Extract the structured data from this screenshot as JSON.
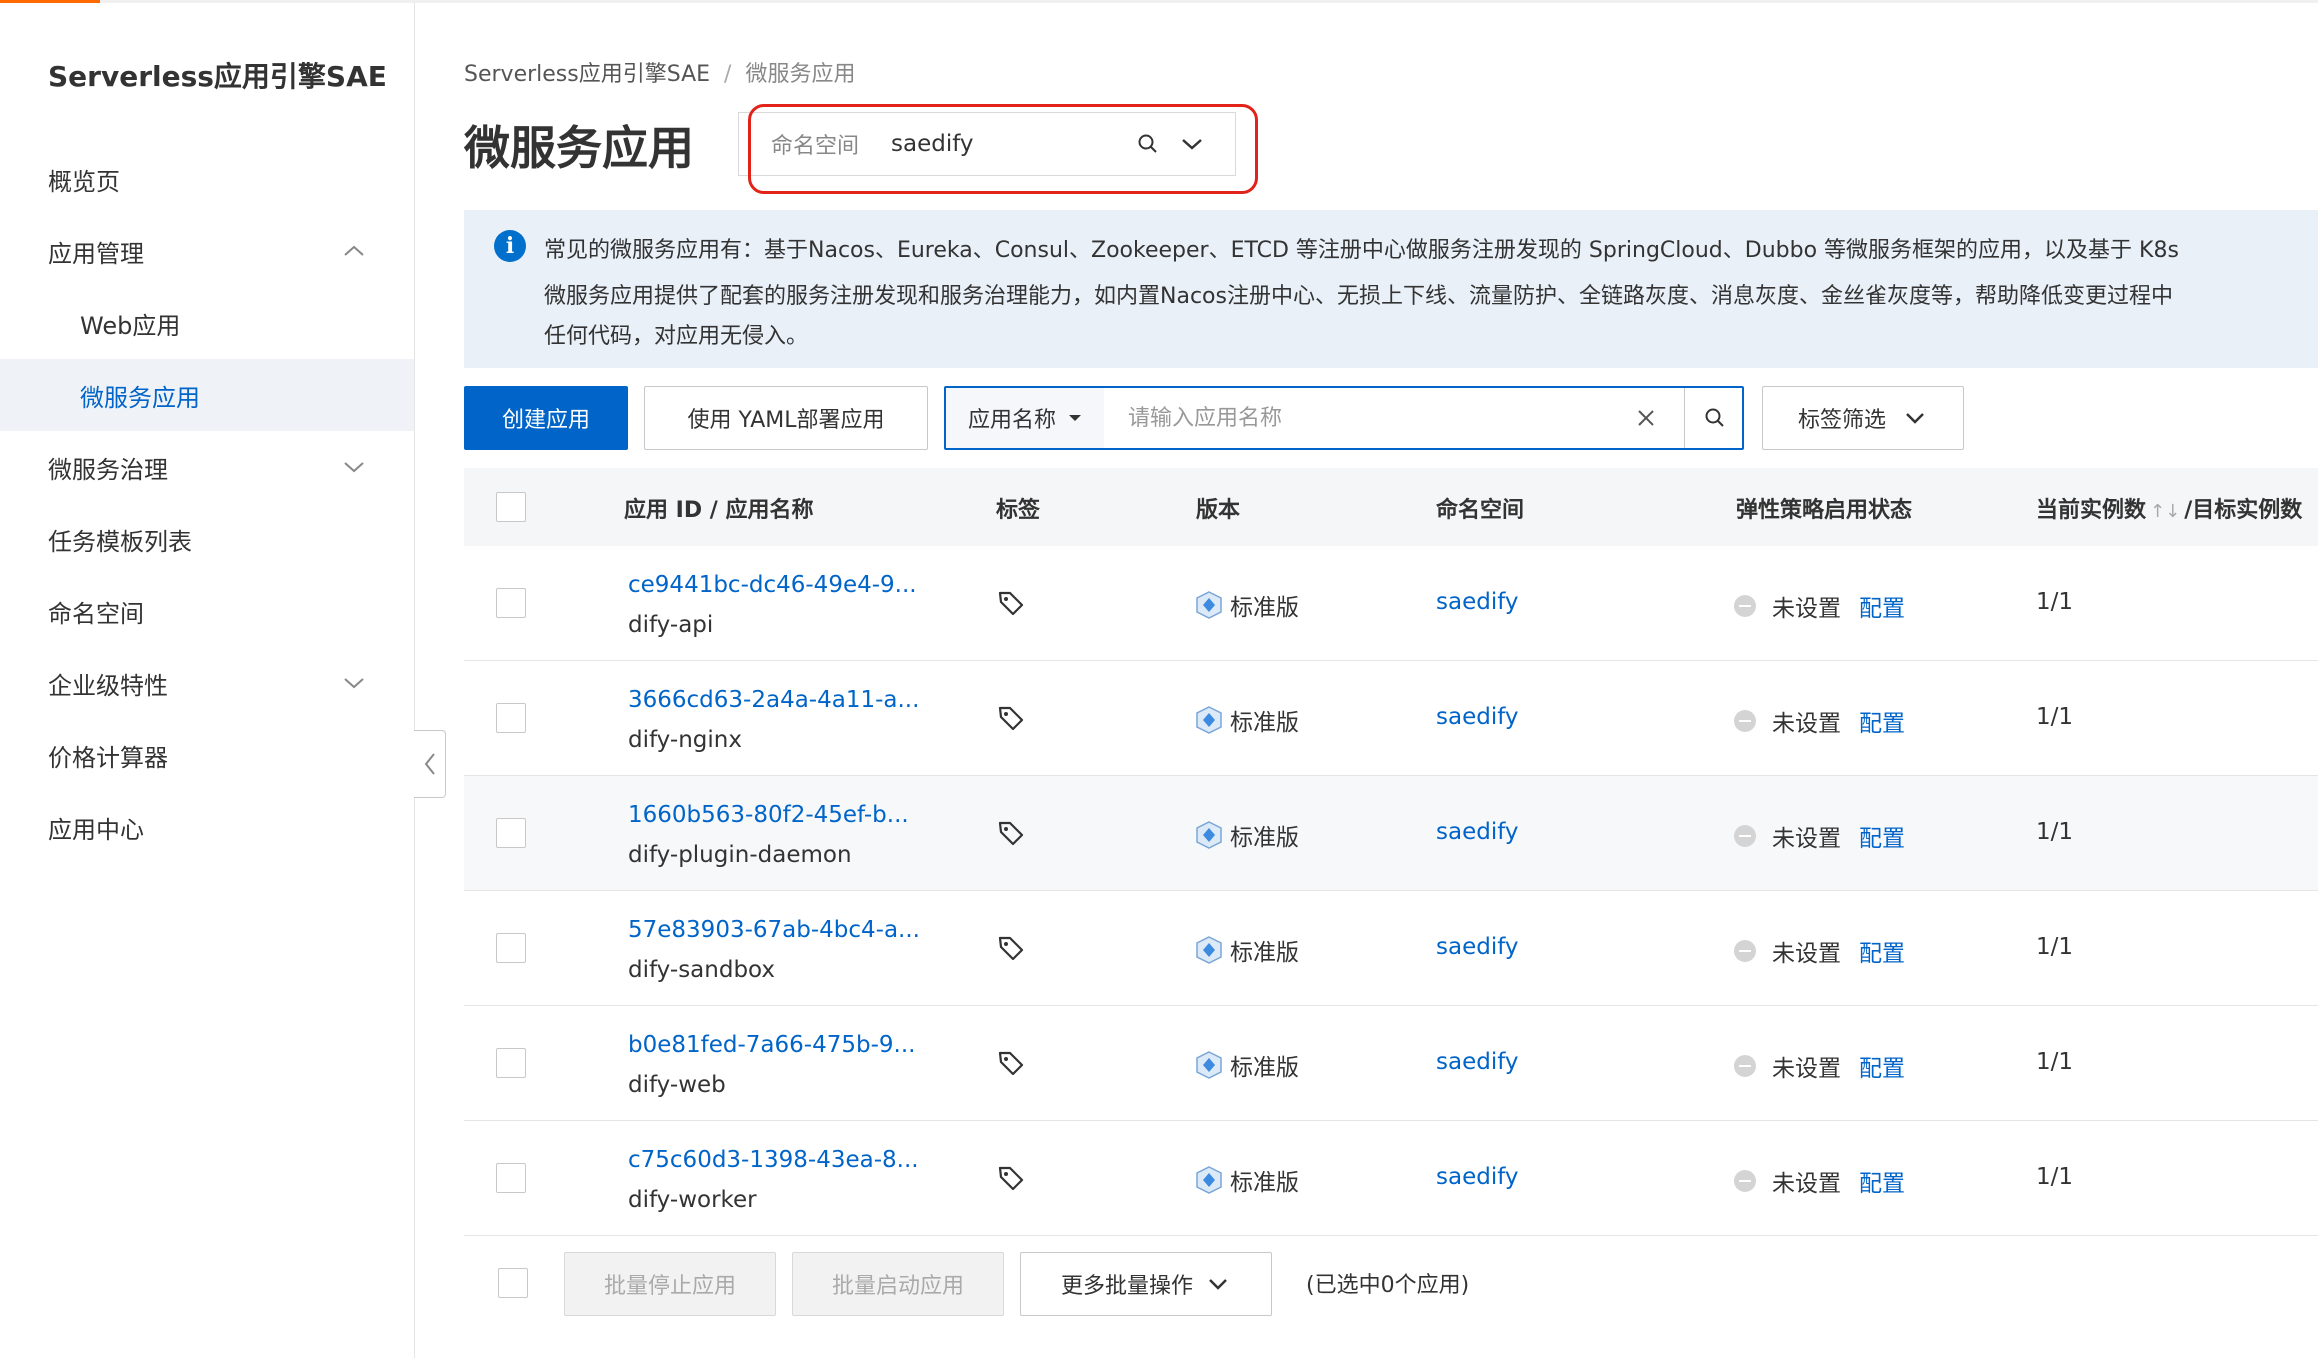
{
  "sidebar": {
    "title": "Serverless应用引擎SAE",
    "items": [
      {
        "label": "概览页"
      },
      {
        "label": "应用管理"
      },
      {
        "label": "Web应用"
      },
      {
        "label": "微服务应用"
      },
      {
        "label": "微服务治理"
      },
      {
        "label": "任务模板列表"
      },
      {
        "label": "命名空间"
      },
      {
        "label": "企业级特性"
      },
      {
        "label": "价格计算器"
      },
      {
        "label": "应用中心"
      }
    ]
  },
  "breadcrumb": {
    "root": "Serverless应用引擎SAE",
    "separator": "/",
    "current": "微服务应用"
  },
  "page_title": "微服务应用",
  "namespace_selector": {
    "label": "命名空间",
    "value": "saedify"
  },
  "notice": {
    "line1": "常见的微服务应用有：基于Nacos、Eureka、Consul、Zookeeper、ETCD 等注册中心做服务注册发现的 SpringCloud、Dubbo 等微服务框架的应用，以及基于 K8s",
    "line2": "微服务应用提供了配套的服务注册发现和服务治理能力，如内置Nacos注册中心、无损上下线、流量防护、全链路灰度、消息灰度、金丝雀灰度等，帮助降低变更过程中",
    "line3": "任何代码，对应用无侵入。"
  },
  "toolbar": {
    "create_label": "创建应用",
    "yaml_label": "使用 YAML部署应用",
    "search_type": "应用名称",
    "search_placeholder": "请输入应用名称",
    "tag_filter_label": "标签筛选"
  },
  "table": {
    "headers": {
      "app": "应用 ID / 应用名称",
      "tags": "标签",
      "version": "版本",
      "namespace": "命名空间",
      "scaling": "弹性策略启用状态",
      "instances": "当前实例数",
      "instances_sort": "↑↓",
      "instances_target": "/目标实例数"
    },
    "rows": [
      {
        "id": "ce9441bc-dc46-49e4-9...",
        "name": "dify-api",
        "version": "标准版",
        "namespace": "saedify",
        "status": "未设置",
        "config": "配置",
        "instances": "1/1"
      },
      {
        "id": "3666cd63-2a4a-4a11-a...",
        "name": "dify-nginx",
        "version": "标准版",
        "namespace": "saedify",
        "status": "未设置",
        "config": "配置",
        "instances": "1/1"
      },
      {
        "id": "1660b563-80f2-45ef-b...",
        "name": "dify-plugin-daemon",
        "version": "标准版",
        "namespace": "saedify",
        "status": "未设置",
        "config": "配置",
        "instances": "1/1"
      },
      {
        "id": "57e83903-67ab-4bc4-a...",
        "name": "dify-sandbox",
        "version": "标准版",
        "namespace": "saedify",
        "status": "未设置",
        "config": "配置",
        "instances": "1/1"
      },
      {
        "id": "b0e81fed-7a66-475b-9...",
        "name": "dify-web",
        "version": "标准版",
        "namespace": "saedify",
        "status": "未设置",
        "config": "配置",
        "instances": "1/1"
      },
      {
        "id": "c75c60d3-1398-43ea-8...",
        "name": "dify-worker",
        "version": "标准版",
        "namespace": "saedify",
        "status": "未设置",
        "config": "配置",
        "instances": "1/1"
      }
    ]
  },
  "footer": {
    "batch_stop": "批量停止应用",
    "batch_start": "批量启动应用",
    "more_batch": "更多批量操作",
    "selected_info": "(已选中0个应用)"
  },
  "colors": {
    "primary": "#0064c8",
    "highlight": "#e2231a",
    "notice_bg": "#e9f0f8"
  }
}
